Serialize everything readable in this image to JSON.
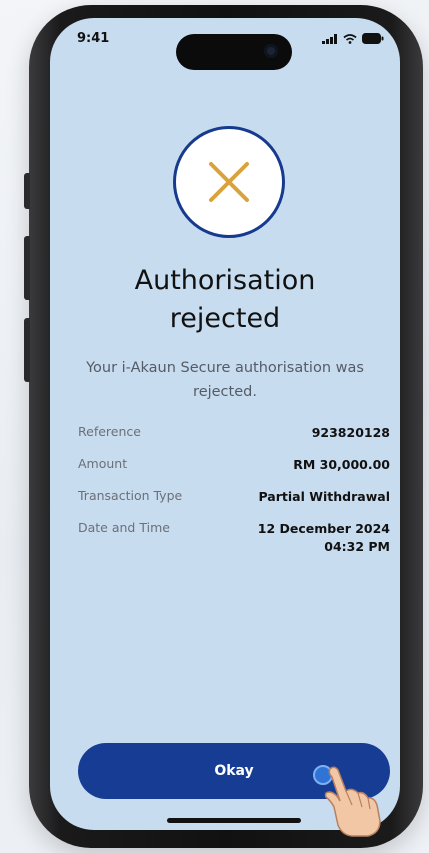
{
  "status_bar": {
    "time": "9:41"
  },
  "result": {
    "icon": "close-icon",
    "title_line1": "Authorisation",
    "title_line2": "rejected",
    "message": "Your i-Akaun Secure authorisation was rejected."
  },
  "details": [
    {
      "label": "Reference",
      "value": "923820128"
    },
    {
      "label": "Amount",
      "value": "RM 30,000.00"
    },
    {
      "label": "Transaction Type",
      "value": "Partial Withdrawal"
    },
    {
      "label": "Date and Time",
      "value_line1": "12 December 2024",
      "value_line2": "04:32 PM"
    }
  ],
  "actions": {
    "okay_label": "Okay"
  },
  "colors": {
    "screen_bg": "#c8dcf0",
    "primary": "#173c94",
    "reject_icon": "#d9a23a"
  }
}
